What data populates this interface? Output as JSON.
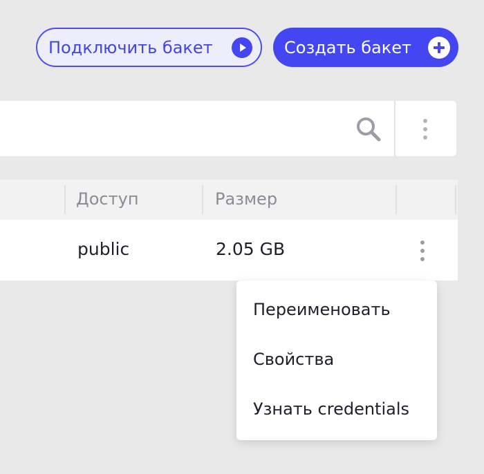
{
  "header": {
    "connect_bucket_label": "Подключить бакет",
    "create_bucket_label": "Создать бакет"
  },
  "search": {
    "icons": [
      "search-icon",
      "more-vertical-icon"
    ]
  },
  "table": {
    "columns": [
      "Доступ",
      "Размер"
    ],
    "rows": [
      {
        "access": "public",
        "size": "2.05 GB"
      }
    ]
  },
  "context_menu": {
    "items": [
      "Переименовать",
      "Свойства",
      "Узнать credentials"
    ]
  },
  "colors": {
    "accent": "#4446f2",
    "background": "#e9e9ea",
    "muted_icon": "#9c9da6"
  }
}
